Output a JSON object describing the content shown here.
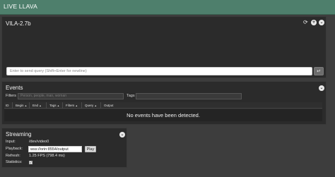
{
  "app": {
    "title": "LIVE LLAVA"
  },
  "model_panel": {
    "title": "VILA-2.7b",
    "icons": [
      "refresh-icon",
      "plus-icon",
      "chevron-down-icon"
    ],
    "query_placeholder": "Enter to send query (Shift+Enter for newline)",
    "send_glyph": "↵"
  },
  "events": {
    "title": "Events",
    "filters_label": "Filters",
    "filters_placeholder": "Person, people, man, woman",
    "tags_label": "Tags",
    "columns": [
      "ID",
      "Begin",
      "End",
      "Tags",
      "Filters",
      "Query",
      "Output"
    ],
    "sort_glyph": "▲",
    "empty_message": "No events have been detected."
  },
  "streaming": {
    "title": "Streaming",
    "input_label": "Input:",
    "input_value": "/dev/video0",
    "playback_label": "Playback:",
    "playback_url": "wss://orin:8554/output",
    "play_label": "Play",
    "refresh_label": "Refresh:",
    "refresh_value": "1.25 FPS (798.4 ms)",
    "statistics_label": "Statistics:",
    "statistics_checked": true,
    "check_glyph": "✔"
  },
  "colors": {
    "topbar": "#4e7f6c",
    "background": "#3d3d3d",
    "panel": "#2b2b2b"
  }
}
